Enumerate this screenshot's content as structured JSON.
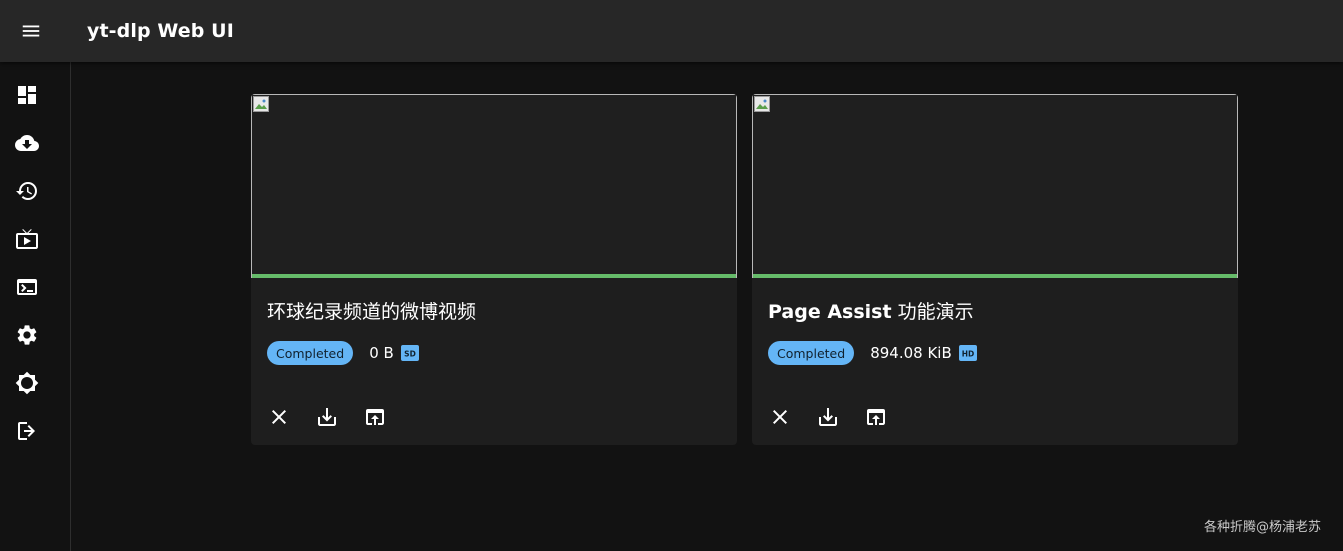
{
  "app": {
    "title": "yt-dlp Web UI",
    "menu_icon": "menu-icon"
  },
  "sidebar": {
    "items": [
      {
        "icon": "dashboard-icon"
      },
      {
        "icon": "cloud-download-icon"
      },
      {
        "icon": "history-icon"
      },
      {
        "icon": "live-tv-icon"
      },
      {
        "icon": "terminal-icon"
      },
      {
        "icon": "settings-icon"
      },
      {
        "icon": "brightness-icon"
      },
      {
        "icon": "logout-icon"
      }
    ]
  },
  "downloads": [
    {
      "title": "环球纪录频道的微博视频",
      "status": "Completed",
      "size": "0 B",
      "quality_badge": "sd-icon",
      "progress": 1.0,
      "actions": [
        "close-icon",
        "download-icon",
        "open-in-browser-icon"
      ]
    },
    {
      "title_bold": "Page Assist",
      "title_rest": " 功能演示",
      "status": "Completed",
      "size": "894.08 KiB",
      "quality_badge": "hd-icon",
      "progress": 1.0,
      "actions": [
        "close-icon",
        "download-icon",
        "open-in-browser-icon"
      ]
    }
  ],
  "colors": {
    "appbar": "#272727",
    "background": "#121212",
    "card": "#1e1e1e",
    "chip": "#64b5f6",
    "progress": "#66bb6a"
  },
  "watermark": "各种折腾@杨浦老苏"
}
